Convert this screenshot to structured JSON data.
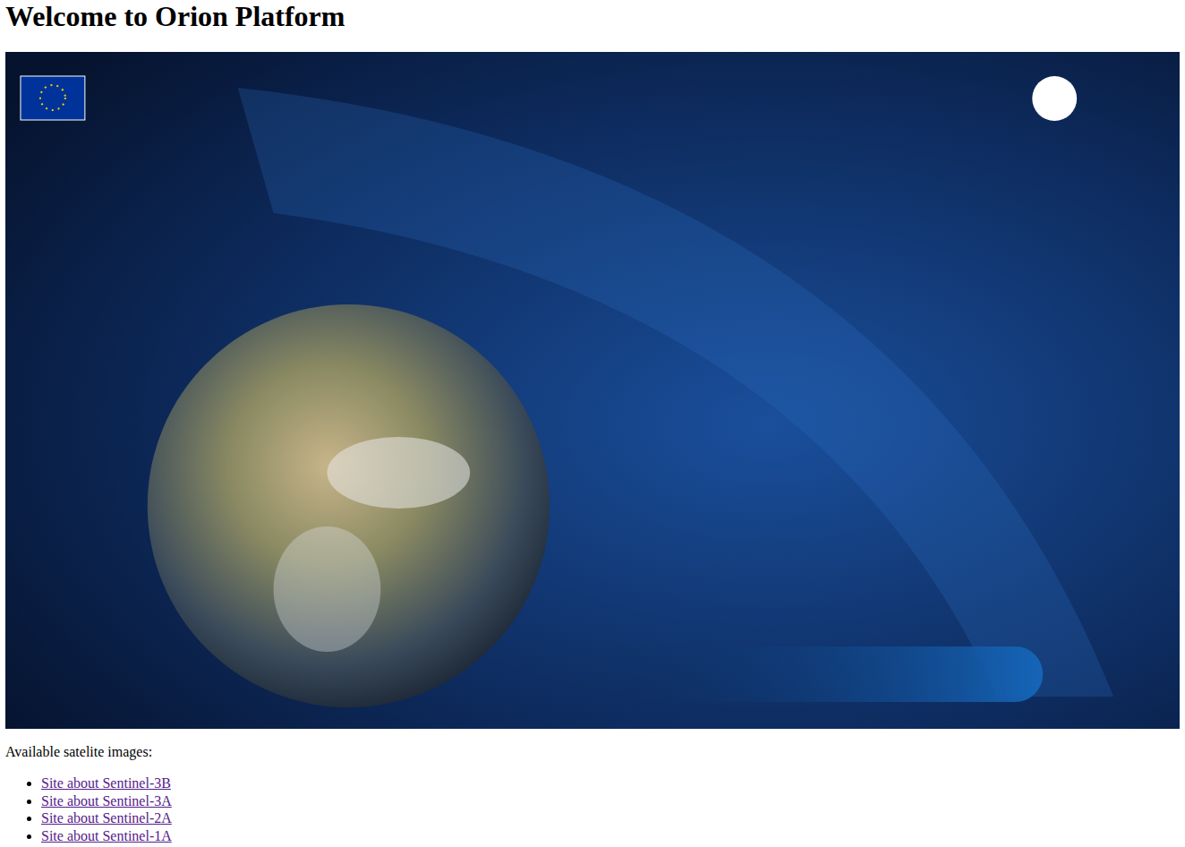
{
  "heading": "Welcome to Orion Platform",
  "intro": "Available satelite images:",
  "links": [
    {
      "label": "Site about Sentinel-3B"
    },
    {
      "label": "Site about Sentinel-3A"
    },
    {
      "label": "Site about Sentinel-2A"
    },
    {
      "label": "Site about Sentinel-1A"
    }
  ]
}
